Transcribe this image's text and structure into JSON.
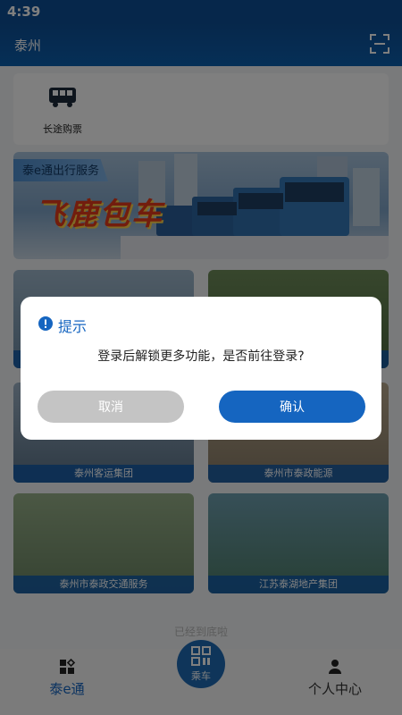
{
  "status_bar": {
    "time": "4:39"
  },
  "header": {
    "title": "泰州",
    "scan_icon": "scan-icon"
  },
  "services": [
    {
      "icon": "bus-icon",
      "label": "长途购票"
    }
  ],
  "banner": {
    "label": "泰e通出行服务",
    "logo_text": "飞鹿包车"
  },
  "tiles": [
    {
      "caption": ""
    },
    {
      "caption": ""
    },
    {
      "caption": "泰州客运集团"
    },
    {
      "caption": "泰州市泰政能源"
    },
    {
      "caption": "泰州市泰政交通服务"
    },
    {
      "caption": "江苏泰湖地产集团"
    }
  ],
  "end_note": "已经到底啦",
  "tab_bar": {
    "home": {
      "icon": "apps-icon",
      "label": "泰e通"
    },
    "ride": {
      "icon": "qr-code-icon",
      "label": "乘车"
    },
    "profile": {
      "icon": "user-icon",
      "label": "个人中心"
    }
  },
  "dialog": {
    "title": "提示",
    "message": "登录后解锁更多功能，是否前往登录?",
    "cancel_label": "取消",
    "confirm_label": "确认"
  },
  "colors": {
    "primary": "#1565c0",
    "header": "#0d4f96",
    "cancel_button": "#c4c4c4",
    "logo_red": "#e43a1a"
  }
}
